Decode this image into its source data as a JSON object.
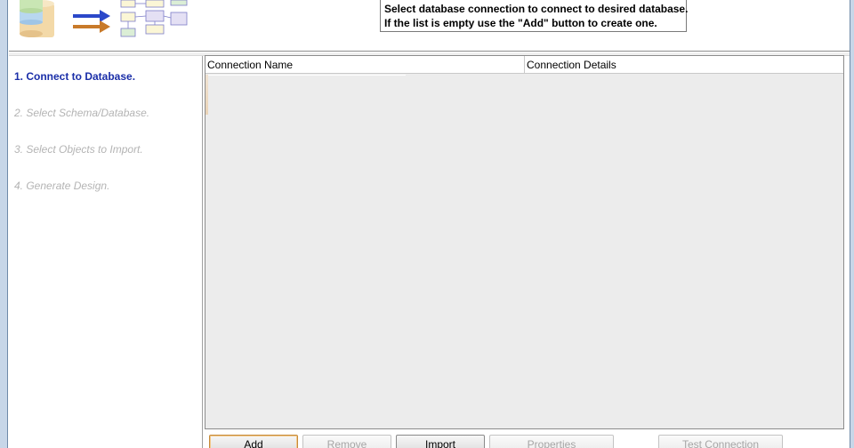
{
  "header": {
    "instructions": [
      "Select database connection to connect to desired database.",
      "If the list is empty use the \"Add\" button to create one."
    ]
  },
  "steps": [
    {
      "label": "1. Connect to Database.",
      "state": "active"
    },
    {
      "label": "2. Select Schema/Database.",
      "state": "disabled"
    },
    {
      "label": "3. Select Objects to Import.",
      "state": "disabled"
    },
    {
      "label": "4. Generate Design.",
      "state": "disabled"
    }
  ],
  "grid": {
    "columns": [
      "Connection Name",
      "Connection Details"
    ],
    "rows": []
  },
  "buttons": {
    "add": {
      "label": "Add",
      "enabled": true
    },
    "remove": {
      "label": "Remove",
      "enabled": false
    },
    "import": {
      "label": "Import",
      "enabled": true
    },
    "properties": {
      "label": "Properties",
      "enabled": false
    },
    "test_connection": {
      "label": "Test Connection",
      "enabled": false
    }
  },
  "colors": {
    "active_step": "#1a2ea8",
    "disabled_step": "#b4b4b4",
    "grid_background": "#ececec",
    "frame": "#c7d6e8"
  },
  "icons": [
    "database-stack-icon",
    "arrow-right-blue-icon",
    "arrow-right-orange-icon",
    "schema-diagram-icon"
  ]
}
